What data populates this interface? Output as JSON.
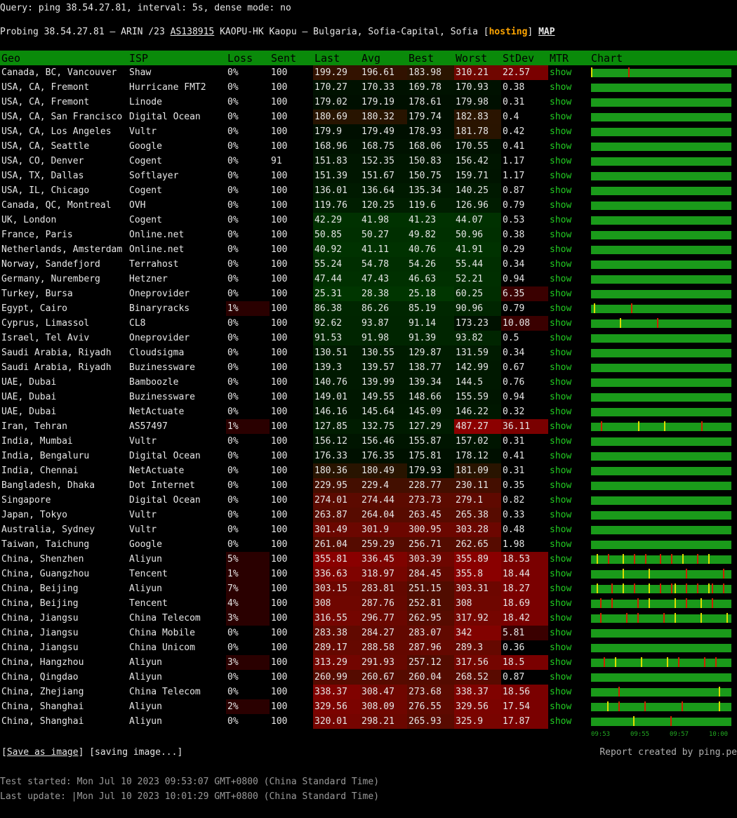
{
  "query": "Query: ping 38.54.27.81, interval: 5s, dense mode: no",
  "probe": {
    "prefix": "Probing 38.54.27.81 – ARIN /23 ",
    "asn": "AS138915",
    "middle": " KAOPU-HK Kaopu – Bulgaria, Sofia-Capital, Sofia [",
    "tag": "hosting",
    "close": "] ",
    "map": "MAP"
  },
  "columns": [
    "Geo",
    "ISP",
    "Loss",
    "Sent",
    "Last",
    "Avg",
    "Best",
    "Worst",
    "StDev",
    "MTR",
    "Chart"
  ],
  "mtr_label": "show",
  "rows": [
    [
      "Canada, BC, Vancouver",
      "Shaw",
      "0%",
      "100",
      "199.29",
      "196.61",
      "183.98",
      "310.21",
      "22.57"
    ],
    [
      "USA, CA, Fremont",
      "Hurricane FMT2",
      "0%",
      "100",
      "170.27",
      "170.33",
      "169.78",
      "170.93",
      "0.38"
    ],
    [
      "USA, CA, Fremont",
      "Linode",
      "0%",
      "100",
      "179.02",
      "179.19",
      "178.61",
      "179.98",
      "0.31"
    ],
    [
      "USA, CA, San Francisco",
      "Digital Ocean",
      "0%",
      "100",
      "180.69",
      "180.32",
      "179.74",
      "182.83",
      "0.4"
    ],
    [
      "USA, CA, Los Angeles",
      "Vultr",
      "0%",
      "100",
      "179.9",
      "179.49",
      "178.93",
      "181.78",
      "0.42"
    ],
    [
      "USA, CA, Seattle",
      "Google",
      "0%",
      "100",
      "168.96",
      "168.75",
      "168.06",
      "170.55",
      "0.41"
    ],
    [
      "USA, CO, Denver",
      "Cogent",
      "0%",
      "91",
      "151.83",
      "152.35",
      "150.83",
      "156.42",
      "1.17"
    ],
    [
      "USA, TX, Dallas",
      "Softlayer",
      "0%",
      "100",
      "151.39",
      "151.67",
      "150.75",
      "159.71",
      "1.17"
    ],
    [
      "USA, IL, Chicago",
      "Cogent",
      "0%",
      "100",
      "136.01",
      "136.64",
      "135.34",
      "140.25",
      "0.87"
    ],
    [
      "Canada, QC, Montreal",
      "OVH",
      "0%",
      "100",
      "119.76",
      "120.25",
      "119.6",
      "126.96",
      "0.79"
    ],
    [
      "UK, London",
      "Cogent",
      "0%",
      "100",
      "42.29",
      "41.98",
      "41.23",
      "44.07",
      "0.53"
    ],
    [
      "France, Paris",
      "Online.net",
      "0%",
      "100",
      "50.85",
      "50.27",
      "49.82",
      "50.96",
      "0.38"
    ],
    [
      "Netherlands, Amsterdam",
      "Online.net",
      "0%",
      "100",
      "40.92",
      "41.11",
      "40.76",
      "41.91",
      "0.29"
    ],
    [
      "Norway, Sandefjord",
      "Terrahost",
      "0%",
      "100",
      "55.24",
      "54.78",
      "54.26",
      "55.44",
      "0.34"
    ],
    [
      "Germany, Nuremberg",
      "Hetzner",
      "0%",
      "100",
      "47.44",
      "47.43",
      "46.63",
      "52.21",
      "0.94"
    ],
    [
      "Turkey, Bursa",
      "Oneprovider",
      "0%",
      "100",
      "25.31",
      "28.38",
      "25.18",
      "60.25",
      "6.35"
    ],
    [
      "Egypt, Cairo",
      "Binaryracks",
      "1%",
      "100",
      "86.38",
      "86.26",
      "85.19",
      "90.96",
      "0.79"
    ],
    [
      "Cyprus, Limassol",
      "CL8",
      "0%",
      "100",
      "92.62",
      "93.87",
      "91.14",
      "173.23",
      "10.08"
    ],
    [
      "Israel, Tel Aviv",
      "Oneprovider",
      "0%",
      "100",
      "91.53",
      "91.98",
      "91.39",
      "93.82",
      "0.5"
    ],
    [
      "Saudi Arabia, Riyadh",
      "Cloudsigma",
      "0%",
      "100",
      "130.51",
      "130.55",
      "129.87",
      "131.59",
      "0.34"
    ],
    [
      "Saudi Arabia, Riyadh",
      "Buzinessware",
      "0%",
      "100",
      "139.3",
      "139.57",
      "138.77",
      "142.99",
      "0.67"
    ],
    [
      "UAE, Dubai",
      "Bamboozle",
      "0%",
      "100",
      "140.76",
      "139.99",
      "139.34",
      "144.5",
      "0.76"
    ],
    [
      "UAE, Dubai",
      "Buzinessware",
      "0%",
      "100",
      "149.01",
      "149.55",
      "148.66",
      "155.59",
      "0.94"
    ],
    [
      "UAE, Dubai",
      "NetActuate",
      "0%",
      "100",
      "146.16",
      "145.64",
      "145.09",
      "146.22",
      "0.32"
    ],
    [
      "Iran, Tehran",
      "AS57497",
      "1%",
      "100",
      "127.85",
      "132.75",
      "127.29",
      "487.27",
      "36.11"
    ],
    [
      "India, Mumbai",
      "Vultr",
      "0%",
      "100",
      "156.12",
      "156.46",
      "155.87",
      "157.02",
      "0.31"
    ],
    [
      "India, Bengaluru",
      "Digital Ocean",
      "0%",
      "100",
      "176.33",
      "176.35",
      "175.81",
      "178.12",
      "0.41"
    ],
    [
      "India, Chennai",
      "NetActuate",
      "0%",
      "100",
      "180.36",
      "180.49",
      "179.93",
      "181.09",
      "0.31"
    ],
    [
      "Bangladesh, Dhaka",
      "Dot Internet",
      "0%",
      "100",
      "229.95",
      "229.4",
      "228.77",
      "230.11",
      "0.35"
    ],
    [
      "Singapore",
      "Digital Ocean",
      "0%",
      "100",
      "274.01",
      "274.44",
      "273.73",
      "279.1",
      "0.82"
    ],
    [
      "Japan, Tokyo",
      "Vultr",
      "0%",
      "100",
      "263.87",
      "264.04",
      "263.45",
      "265.38",
      "0.33"
    ],
    [
      "Australia, Sydney",
      "Vultr",
      "0%",
      "100",
      "301.49",
      "301.9",
      "300.95",
      "303.28",
      "0.48"
    ],
    [
      "Taiwan, Taichung",
      "Google",
      "0%",
      "100",
      "261.04",
      "259.29",
      "256.71",
      "262.65",
      "1.98"
    ],
    [
      "China, Shenzhen",
      "Aliyun",
      "5%",
      "100",
      "355.81",
      "336.45",
      "303.39",
      "355.89",
      "18.53"
    ],
    [
      "China, Guangzhou",
      "Tencent",
      "1%",
      "100",
      "336.63",
      "318.97",
      "284.45",
      "355.8",
      "18.44"
    ],
    [
      "China, Beijing",
      "Aliyun",
      "7%",
      "100",
      "303.15",
      "283.81",
      "251.15",
      "303.31",
      "18.27"
    ],
    [
      "China, Beijing",
      "Tencent",
      "4%",
      "100",
      "308",
      "287.76",
      "252.81",
      "308",
      "18.69"
    ],
    [
      "China, Jiangsu",
      "China Telecom",
      "3%",
      "100",
      "316.55",
      "296.77",
      "262.95",
      "317.92",
      "18.42"
    ],
    [
      "China, Jiangsu",
      "China Mobile",
      "0%",
      "100",
      "283.38",
      "284.27",
      "283.07",
      "342",
      "5.81"
    ],
    [
      "China, Jiangsu",
      "China Unicom",
      "0%",
      "100",
      "289.17",
      "288.58",
      "287.96",
      "289.3",
      "0.36"
    ],
    [
      "China, Hangzhou",
      "Aliyun",
      "3%",
      "100",
      "313.29",
      "291.93",
      "257.12",
      "317.56",
      "18.5"
    ],
    [
      "China, Qingdao",
      "Aliyun",
      "0%",
      "100",
      "260.99",
      "260.67",
      "260.04",
      "268.52",
      "0.87"
    ],
    [
      "China, Zhejiang",
      "China Telecom",
      "0%",
      "100",
      "338.37",
      "308.47",
      "273.68",
      "338.37",
      "18.56"
    ],
    [
      "China, Shanghai",
      "Aliyun",
      "2%",
      "100",
      "329.56",
      "308.09",
      "276.55",
      "329.56",
      "17.54"
    ],
    [
      "China, Shanghai",
      "Aliyun",
      "0%",
      "100",
      "320.01",
      "298.21",
      "265.93",
      "325.9",
      "17.87"
    ]
  ],
  "chart_ticks": [
    "09:53",
    "09:55",
    "09:57",
    "10:00"
  ],
  "colors": {
    "header": "#0a8a0a",
    "bar": "#1a9a1a",
    "link": "#22cc22",
    "accent": "#ffa500"
  },
  "save": {
    "open": "[",
    "label": "Save as image",
    "close": "] [saving image...]"
  },
  "report": "Report created by ping.pe",
  "test_started": "Test started: Mon Jul 10 2023 09:53:07 GMT+0800 (China Standard Time)",
  "last_update": "Last update: |Mon Jul 10 2023 10:01:29 GMT+0800 (China Standard Time)"
}
